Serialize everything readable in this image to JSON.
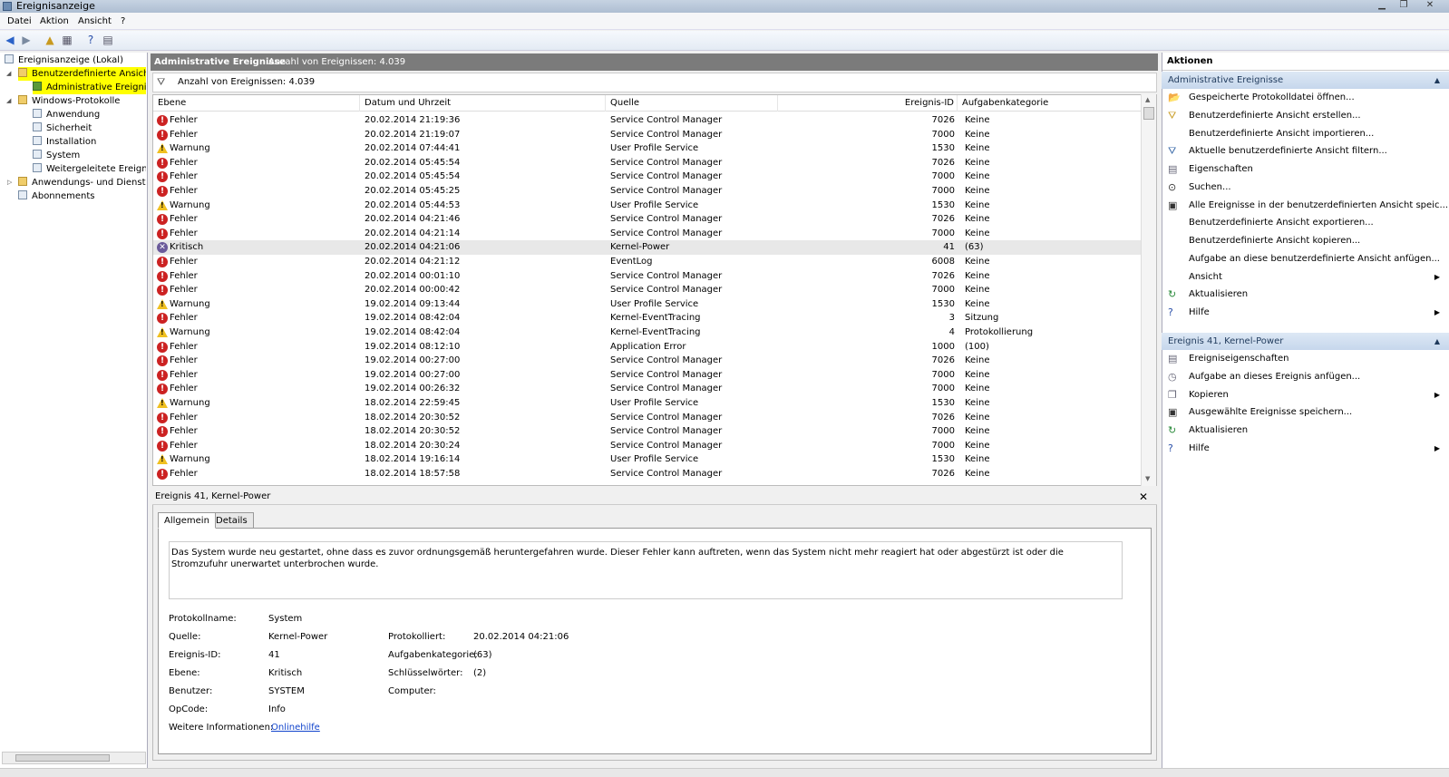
{
  "window": {
    "title": "Ereignisanzeige"
  },
  "menu": [
    "Datei",
    "Aktion",
    "Ansicht",
    "?"
  ],
  "tree": {
    "root": "Ereignisanzeige (Lokal)",
    "custom_views": "Benutzerdefinierte Ansichten",
    "admin_events": "Administrative Ereignisse",
    "windows_logs": "Windows-Protokolle",
    "application": "Anwendung",
    "security": "Sicherheit",
    "installation": "Installation",
    "system": "System",
    "forwarded": "Weitergeleitete Ereignisse",
    "app_services": "Anwendungs- und Dienstprotokolle",
    "subscriptions": "Abonnements"
  },
  "center": {
    "title": "Administrative Ereignisse",
    "count_header": "Anzahl von Ereignissen: 4.039",
    "count_filter": "Anzahl von Ereignissen: 4.039",
    "columns": [
      "Ebene",
      "Datum und Uhrzeit",
      "Quelle",
      "Ereignis-ID",
      "Aufgabenkategorie"
    ],
    "rows": [
      {
        "level": "Fehler",
        "type": "err",
        "date": "20.02.2014 21:19:36",
        "source": "Service Control Manager",
        "id": "7026",
        "cat": "Keine"
      },
      {
        "level": "Fehler",
        "type": "err",
        "date": "20.02.2014 21:19:07",
        "source": "Service Control Manager",
        "id": "7000",
        "cat": "Keine"
      },
      {
        "level": "Warnung",
        "type": "warn",
        "date": "20.02.2014 07:44:41",
        "source": "User Profile Service",
        "id": "1530",
        "cat": "Keine"
      },
      {
        "level": "Fehler",
        "type": "err",
        "date": "20.02.2014 05:45:54",
        "source": "Service Control Manager",
        "id": "7026",
        "cat": "Keine"
      },
      {
        "level": "Fehler",
        "type": "err",
        "date": "20.02.2014 05:45:54",
        "source": "Service Control Manager",
        "id": "7000",
        "cat": "Keine"
      },
      {
        "level": "Fehler",
        "type": "err",
        "date": "20.02.2014 05:45:25",
        "source": "Service Control Manager",
        "id": "7000",
        "cat": "Keine"
      },
      {
        "level": "Warnung",
        "type": "warn",
        "date": "20.02.2014 05:44:53",
        "source": "User Profile Service",
        "id": "1530",
        "cat": "Keine"
      },
      {
        "level": "Fehler",
        "type": "err",
        "date": "20.02.2014 04:21:46",
        "source": "Service Control Manager",
        "id": "7026",
        "cat": "Keine"
      },
      {
        "level": "Fehler",
        "type": "err",
        "date": "20.02.2014 04:21:14",
        "source": "Service Control Manager",
        "id": "7000",
        "cat": "Keine"
      },
      {
        "level": "Kritisch",
        "type": "crit",
        "date": "20.02.2014 04:21:06",
        "source": "Kernel-Power",
        "id": "41",
        "cat": "(63)"
      },
      {
        "level": "Fehler",
        "type": "err",
        "date": "20.02.2014 04:21:12",
        "source": "EventLog",
        "id": "6008",
        "cat": "Keine"
      },
      {
        "level": "Fehler",
        "type": "err",
        "date": "20.02.2014 00:01:10",
        "source": "Service Control Manager",
        "id": "7026",
        "cat": "Keine"
      },
      {
        "level": "Fehler",
        "type": "err",
        "date": "20.02.2014 00:00:42",
        "source": "Service Control Manager",
        "id": "7000",
        "cat": "Keine"
      },
      {
        "level": "Warnung",
        "type": "warn",
        "date": "19.02.2014 09:13:44",
        "source": "User Profile Service",
        "id": "1530",
        "cat": "Keine"
      },
      {
        "level": "Fehler",
        "type": "err",
        "date": "19.02.2014 08:42:04",
        "source": "Kernel-EventTracing",
        "id": "3",
        "cat": "Sitzung"
      },
      {
        "level": "Warnung",
        "type": "warn",
        "date": "19.02.2014 08:42:04",
        "source": "Kernel-EventTracing",
        "id": "4",
        "cat": "Protokollierung"
      },
      {
        "level": "Fehler",
        "type": "err",
        "date": "19.02.2014 08:12:10",
        "source": "Application Error",
        "id": "1000",
        "cat": "(100)"
      },
      {
        "level": "Fehler",
        "type": "err",
        "date": "19.02.2014 00:27:00",
        "source": "Service Control Manager",
        "id": "7026",
        "cat": "Keine"
      },
      {
        "level": "Fehler",
        "type": "err",
        "date": "19.02.2014 00:27:00",
        "source": "Service Control Manager",
        "id": "7000",
        "cat": "Keine"
      },
      {
        "level": "Fehler",
        "type": "err",
        "date": "19.02.2014 00:26:32",
        "source": "Service Control Manager",
        "id": "7000",
        "cat": "Keine"
      },
      {
        "level": "Warnung",
        "type": "warn",
        "date": "18.02.2014 22:59:45",
        "source": "User Profile Service",
        "id": "1530",
        "cat": "Keine"
      },
      {
        "level": "Fehler",
        "type": "err",
        "date": "18.02.2014 20:30:52",
        "source": "Service Control Manager",
        "id": "7026",
        "cat": "Keine"
      },
      {
        "level": "Fehler",
        "type": "err",
        "date": "18.02.2014 20:30:52",
        "source": "Service Control Manager",
        "id": "7000",
        "cat": "Keine"
      },
      {
        "level": "Fehler",
        "type": "err",
        "date": "18.02.2014 20:30:24",
        "source": "Service Control Manager",
        "id": "7000",
        "cat": "Keine"
      },
      {
        "level": "Warnung",
        "type": "warn",
        "date": "18.02.2014 19:16:14",
        "source": "User Profile Service",
        "id": "1530",
        "cat": "Keine"
      },
      {
        "level": "Fehler",
        "type": "err",
        "date": "18.02.2014 18:57:58",
        "source": "Service Control Manager",
        "id": "7026",
        "cat": "Keine"
      }
    ],
    "selected_index": 9
  },
  "detail": {
    "title": "Ereignis 41, Kernel-Power",
    "tab_general": "Allgemein",
    "tab_details": "Details",
    "description": "Das System wurde neu gestartet, ohne dass es zuvor ordnungsgemäß heruntergefahren wurde. Dieser Fehler kann auftreten, wenn das System nicht mehr reagiert hat oder abgestürzt ist oder die Stromzufuhr unerwartet unterbrochen wurde.",
    "log_name_label": "Protokollname:",
    "log_name": "System",
    "source_label": "Quelle:",
    "source": "Kernel-Power",
    "logged_label": "Protokolliert:",
    "logged": "20.02.2014 04:21:06",
    "event_id_label": "Ereignis-ID:",
    "event_id": "41",
    "task_label": "Aufgabenkategorie:",
    "task": "(63)",
    "level_label": "Ebene:",
    "level": "Kritisch",
    "keywords_label": "Schlüsselwörter:",
    "keywords": "(2)",
    "user_label": "Benutzer:",
    "user": "SYSTEM",
    "computer_label": "Computer:",
    "opcode_label": "OpCode:",
    "opcode": "Info",
    "more_info_label": "Weitere Informationen:",
    "more_info_link": "Onlinehilfe"
  },
  "actions": {
    "header": "Aktionen",
    "section1": "Administrative Ereignisse",
    "items1": [
      {
        "label": "Gespeicherte Protokolldatei öffnen...",
        "icon": "folder-open-icon",
        "sub": false
      },
      {
        "label": "Benutzerdefinierte Ansicht erstellen...",
        "icon": "filter-create-icon",
        "sub": false
      },
      {
        "label": "Benutzerdefinierte Ansicht importieren...",
        "icon": "",
        "sub": false
      },
      {
        "label": "Aktuelle benutzerdefinierte Ansicht filtern...",
        "icon": "filter-icon",
        "sub": false
      },
      {
        "label": "Eigenschaften",
        "icon": "properties-icon",
        "sub": false
      },
      {
        "label": "Suchen...",
        "icon": "binoculars-icon",
        "sub": false
      },
      {
        "label": "Alle Ereignisse in der benutzerdefinierten Ansicht speic...",
        "icon": "save-icon",
        "sub": false
      },
      {
        "label": "Benutzerdefinierte Ansicht exportieren...",
        "icon": "",
        "sub": false
      },
      {
        "label": "Benutzerdefinierte Ansicht kopieren...",
        "icon": "",
        "sub": false
      },
      {
        "label": "Aufgabe an diese benutzerdefinierte Ansicht anfügen...",
        "icon": "",
        "sub": false
      },
      {
        "label": "Ansicht",
        "icon": "",
        "sub": true
      },
      {
        "label": "Aktualisieren",
        "icon": "refresh-icon",
        "sub": false
      },
      {
        "label": "Hilfe",
        "icon": "help-icon",
        "sub": true
      }
    ],
    "section2": "Ereignis 41, Kernel-Power",
    "items2": [
      {
        "label": "Ereigniseigenschaften",
        "icon": "event-properties-icon",
        "sub": false
      },
      {
        "label": "Aufgabe an dieses Ereignis anfügen...",
        "icon": "task-icon",
        "sub": false
      },
      {
        "label": "Kopieren",
        "icon": "copy-icon",
        "sub": true
      },
      {
        "label": "Ausgewählte Ereignisse speichern...",
        "icon": "save-icon",
        "sub": false
      },
      {
        "label": "Aktualisieren",
        "icon": "refresh-icon",
        "sub": false
      },
      {
        "label": "Hilfe",
        "icon": "help-icon",
        "sub": true
      }
    ]
  },
  "colors": {
    "selection": "#ffff00",
    "section_header": "#c6d7ec",
    "error": "#cc2222",
    "warning": "#f0c020"
  }
}
